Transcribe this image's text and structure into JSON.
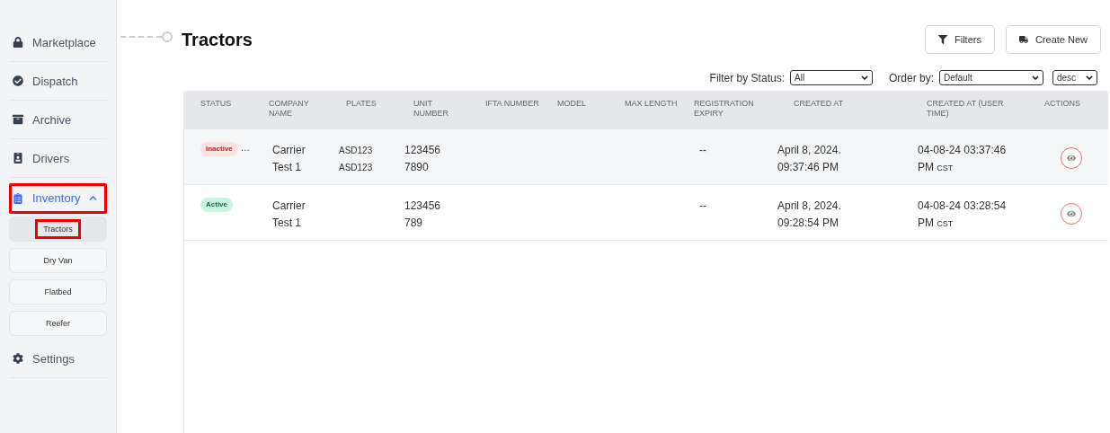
{
  "sidebar": {
    "items": [
      {
        "label": "Marketplace",
        "selected": false
      },
      {
        "label": "Dispatch",
        "selected": false
      },
      {
        "label": "Archive",
        "selected": false
      },
      {
        "label": "Drivers",
        "selected": false
      },
      {
        "label": "Inventory",
        "selected": true,
        "expanded": true,
        "annotated": true,
        "children": [
          {
            "label": "Tractors",
            "selected": true,
            "annotated": true
          },
          {
            "label": "Dry Van",
            "selected": false,
            "annotated": false
          },
          {
            "label": "Flatbed",
            "selected": false,
            "annotated": false
          },
          {
            "label": "Reefer",
            "selected": false,
            "annotated": false
          }
        ]
      },
      {
        "label": "Settings",
        "selected": false
      }
    ]
  },
  "page": {
    "title": "Tractors",
    "buttons": [
      {
        "label": "Filters"
      },
      {
        "label": "Create New"
      }
    ],
    "filter_by_status": {
      "label": "Filter by Status:",
      "value": "All"
    },
    "order_by": {
      "label": "Order by:",
      "value": "Default",
      "direction": "desc"
    }
  },
  "table": {
    "columns": [
      "STATUS",
      "COMPANY NAME",
      "PLATES",
      "UNIT NUMBER",
      "IFTA NUMBER",
      "MODEL",
      "MAX LENGTH",
      "REGISTRATION EXPIRY",
      "CREATED AT",
      "CREATED AT (USER TIME)",
      "ACTIONS"
    ],
    "rows": [
      {
        "status": "Inactive",
        "kind": "inactive",
        "status_suffix": "…",
        "company": "Carrier Test 1",
        "plates": [
          "ASD123",
          "ASD123"
        ],
        "unit_number": "1234567890",
        "registration_expiry": "--",
        "created_at": "April 8, 2024. 09:37:46 PM",
        "created_user": "04-08-24 03:37:46 PM",
        "tz": "CST"
      },
      {
        "status": "Active",
        "kind": "active",
        "company": "Carrier Test 1",
        "plates": [],
        "unit_number": "123456789",
        "registration_expiry": "--",
        "created_at": "April 8, 2024. 09:28:54 PM",
        "created_user": "04-08-24 03:28:54 PM",
        "tz": "CST"
      }
    ]
  }
}
